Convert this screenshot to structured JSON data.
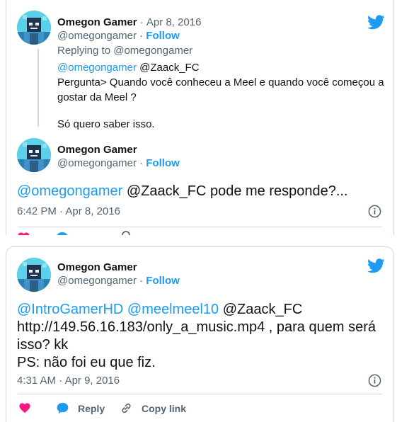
{
  "tweet1": {
    "author_name": "Omegon Gamer",
    "date_prefix": "·",
    "date": "Apr 8, 2016",
    "handle": "@omegongamer",
    "follow_sep": "·",
    "follow": "Follow",
    "replying_to": "Replying to @omegongamer",
    "mention1": "@omegongamer",
    "mention2": " @Zaack_FC",
    "line1": "Pergunta> Quando você conheceu a Meel e quando você começou a",
    "line2": "gostar da Meel ?",
    "line3": "Só quero saber isso."
  },
  "tweet1_reply": {
    "author_name": "Omegon Gamer",
    "handle": "@omegongamer",
    "follow_sep": "·",
    "follow": "Follow",
    "mention": "@omegongamer",
    "text": " @Zaack_FC pode me responde?...",
    "time": "6:42 PM",
    "time_sep": "·",
    "date": "Apr 8, 2016"
  },
  "tweet2": {
    "author_name": "Omegon Gamer",
    "handle": "@omegongamer",
    "follow_sep": "·",
    "follow": "Follow",
    "mention1": "@IntroGamerHD",
    "mention2": "@meelmeel10",
    "mention3": " @Zaack_FC",
    "line2": "http://149.56.16.183/only_a_music.mp4 , para quem será",
    "line3": "isso? kk",
    "line4": "PS: não foi eu que fiz.",
    "time": "4:31 AM",
    "time_sep": "·",
    "date": "Apr 9, 2016",
    "reply_label": "Reply",
    "copy_link_label": "Copy link"
  },
  "colors": {
    "accent": "#1d9bf0",
    "like": "#f91880",
    "muted": "#536471",
    "text": "#0f1419",
    "border": "#cfd9de"
  },
  "icons": [
    "twitter-bird-icon",
    "info-icon",
    "heart-icon",
    "reply-bubble-icon",
    "copy-link-icon"
  ]
}
